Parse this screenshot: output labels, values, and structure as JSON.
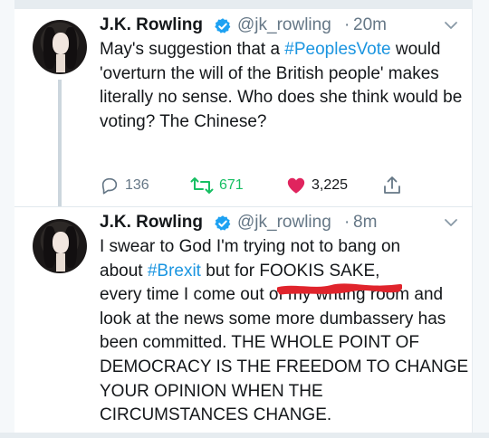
{
  "tweets": [
    {
      "author": "J.K. Rowling",
      "handle": "@jk_rowling",
      "separator": "·",
      "time": "20m",
      "text_before": "May's suggestion that a ",
      "hashtag": "#PeoplesVote",
      "text_after": " would 'overturn the will of the British people' makes literally no sense. Who does she think would be voting? The Chinese?",
      "replies": "136",
      "retweets": "671",
      "likes": "3,225"
    },
    {
      "author": "J.K. Rowling",
      "handle": "@jk_rowling",
      "separator": "·",
      "time": "8m",
      "line1": "I swear to God I'm trying not to bang on",
      "line2_before": "about ",
      "hashtag": "#Brexit",
      "line2_after": " but for ",
      "censored_text": "FOOKIS SAKE,",
      "text_rest": "every time I come out of my writing room and look at the news some more dumbassery has been committed. THE WHOLE POINT OF DEMOCRACY IS THE FREEDOM TO CHANGE YOUR OPINION WHEN THE CIRCUMSTANCES CHANGE."
    }
  ],
  "colors": {
    "hashtag": "#1b95e0",
    "verified": "#1da1f2",
    "retweet": "#17bf63",
    "like": "#e0245e",
    "muted": "#657786",
    "scribble": "#e0242c"
  },
  "icons": {
    "verified": "verified-badge-icon",
    "chevron": "chevron-down-icon",
    "reply": "reply-icon",
    "retweet": "retweet-icon",
    "like": "heart-icon",
    "share": "share-icon"
  }
}
